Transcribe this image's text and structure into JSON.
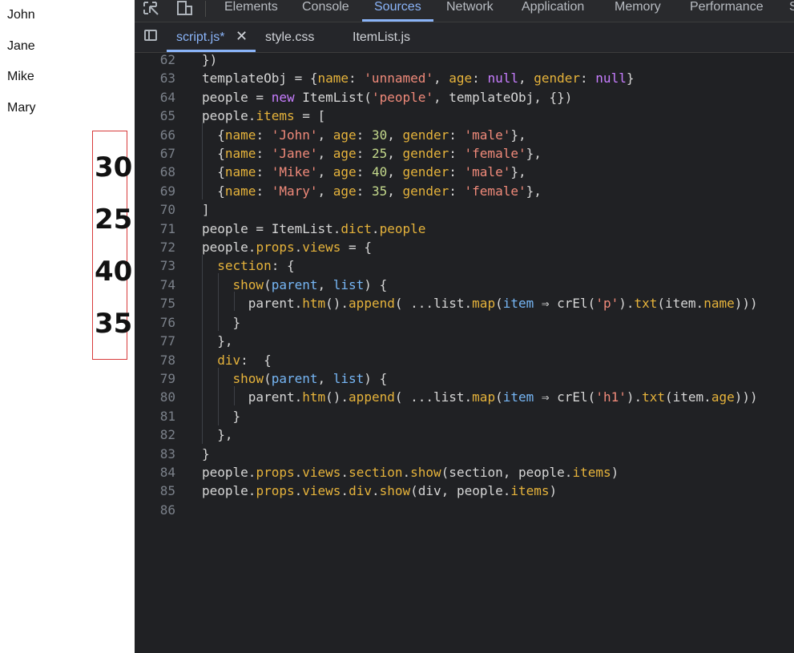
{
  "page": {
    "names": [
      "John",
      "Jane",
      "Mike",
      "Mary"
    ],
    "ages": [
      "30",
      "25",
      "40",
      "35"
    ]
  },
  "devtools": {
    "tabs": [
      "Elements",
      "Console",
      "Sources",
      "Network",
      "Application",
      "Memory",
      "Performance",
      "S"
    ],
    "active_tab": "Sources",
    "file_tabs": [
      "script.js*",
      "style.css",
      "ItemList.js"
    ],
    "active_file": "script.js*",
    "close_symbol": "✕"
  },
  "editor": {
    "line_numbers": [
      "62",
      "63",
      "64",
      "65",
      "66",
      "67",
      "68",
      "69",
      "70",
      "71",
      "72",
      "73",
      "74",
      "75",
      "76",
      "77",
      "78",
      "79",
      "80",
      "81",
      "82",
      "83",
      "84",
      "85",
      "86"
    ]
  },
  "colors": {
    "accent": "#8ab4f8",
    "highlight_border": "#d73a3a"
  }
}
